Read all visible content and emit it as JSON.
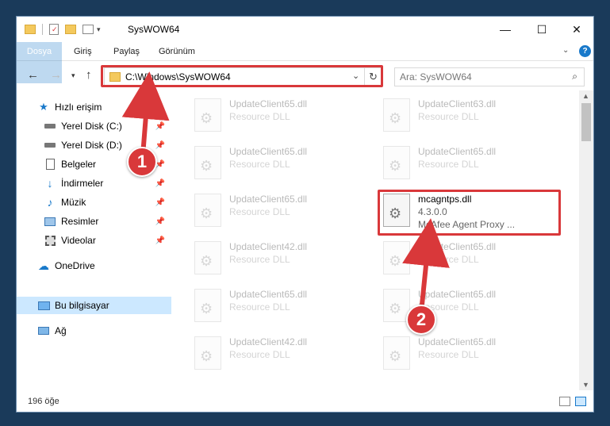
{
  "window": {
    "title": "SysWOW64"
  },
  "ribbon": {
    "tabs": [
      "Dosya",
      "Giriş",
      "Paylaş",
      "Görünüm"
    ]
  },
  "address": {
    "path": "C:\\Windows\\SysWOW64"
  },
  "search": {
    "placeholder": "Ara: SysWOW64"
  },
  "sidebar": {
    "items": [
      {
        "label": "Hızlı erişim",
        "icon": "star-icon"
      },
      {
        "label": "Yerel Disk (C:)",
        "icon": "drive-icon"
      },
      {
        "label": "Yerel Disk (D:)",
        "icon": "drive-icon"
      },
      {
        "label": "Belgeler",
        "icon": "documents-icon"
      },
      {
        "label": "İndirmeler",
        "icon": "download-icon"
      },
      {
        "label": "Müzik",
        "icon": "music-icon"
      },
      {
        "label": "Resimler",
        "icon": "pictures-icon"
      },
      {
        "label": "Videolar",
        "icon": "video-icon"
      },
      {
        "label": "OneDrive",
        "icon": "cloud-icon"
      },
      {
        "label": "Bu bilgisayar",
        "icon": "computer-icon"
      },
      {
        "label": "Ağ",
        "icon": "network-icon"
      }
    ]
  },
  "files": [
    {
      "name": "UpdateClient65.dll",
      "type": "Resource DLL"
    },
    {
      "name": "UpdateClient63.dll",
      "type": "Resource DLL"
    },
    {
      "name": "UpdateClient65.dll",
      "type": "Resource DLL"
    },
    {
      "name": "UpdateClient65.dll",
      "type": "Resource DLL"
    },
    {
      "name": "UpdateClient65.dll",
      "type": "Resource DLL"
    },
    {
      "name": "mcagntps.dll",
      "type": "4.3.0.0",
      "desc": "McAfee Agent Proxy ..."
    },
    {
      "name": "UpdateClient42.dll",
      "type": "Resource DLL"
    },
    {
      "name": "UpdateClient65.dll",
      "type": "Resource DLL"
    },
    {
      "name": "UpdateClient65.dll",
      "type": "Resource DLL"
    },
    {
      "name": "UpdateClient65.dll",
      "type": "Resource DLL"
    },
    {
      "name": "UpdateClient42.dll",
      "type": "Resource DLL"
    },
    {
      "name": "UpdateClient65.dll",
      "type": "Resource DLL"
    }
  ],
  "status": {
    "count": "196 öğe"
  },
  "callouts": [
    "1",
    "2"
  ],
  "colors": {
    "accent": "#1979ca",
    "highlight": "#d9383a",
    "selection": "#cce8ff"
  }
}
